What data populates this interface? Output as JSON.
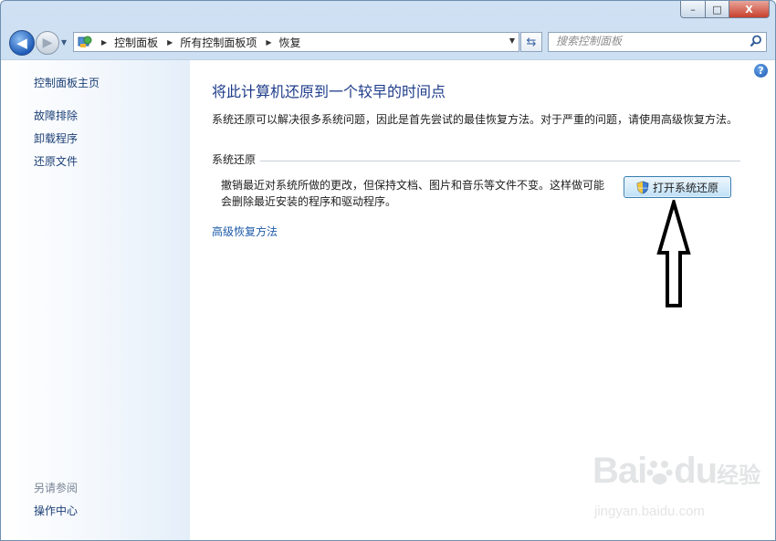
{
  "window": {
    "caption": {
      "minimize": "–",
      "maximize": "□",
      "close": "X"
    }
  },
  "nav": {
    "back_glyph": "◀",
    "forward_glyph": "▶",
    "breadcrumb": [
      "控制面板",
      "所有控制面板项",
      "恢复"
    ],
    "search_placeholder": "搜索控制面板"
  },
  "sidebar": {
    "home": "控制面板主页",
    "items": [
      "故障排除",
      "卸载程序",
      "还原文件"
    ],
    "see_also_title": "另请参阅",
    "see_also_items": [
      "操作中心"
    ]
  },
  "main": {
    "help": "?",
    "title": "将此计算机还原到一个较早的时间点",
    "description": "系统还原可以解决很多系统问题，因此是首先尝试的最佳恢复方法。对于严重的问题，请使用高级恢复方法。",
    "section_title": "系统还原",
    "section_text_line1": "撤销最近对系统所做的更改，但保持文档、图片和音乐等文件不变。这样做可能",
    "section_text_line2": "会删除最近安装的程序和驱动程序。",
    "button_label": "打开系统还原",
    "advanced_link": "高级恢复方法"
  },
  "watermark": {
    "brand": "Bai",
    "brand2": "du",
    "cn": "经验",
    "url": "jingyan.baidu.com"
  },
  "colors": {
    "accent": "#1e3c8a",
    "link": "#1c3f75",
    "button_border": "#3c7fb1"
  }
}
